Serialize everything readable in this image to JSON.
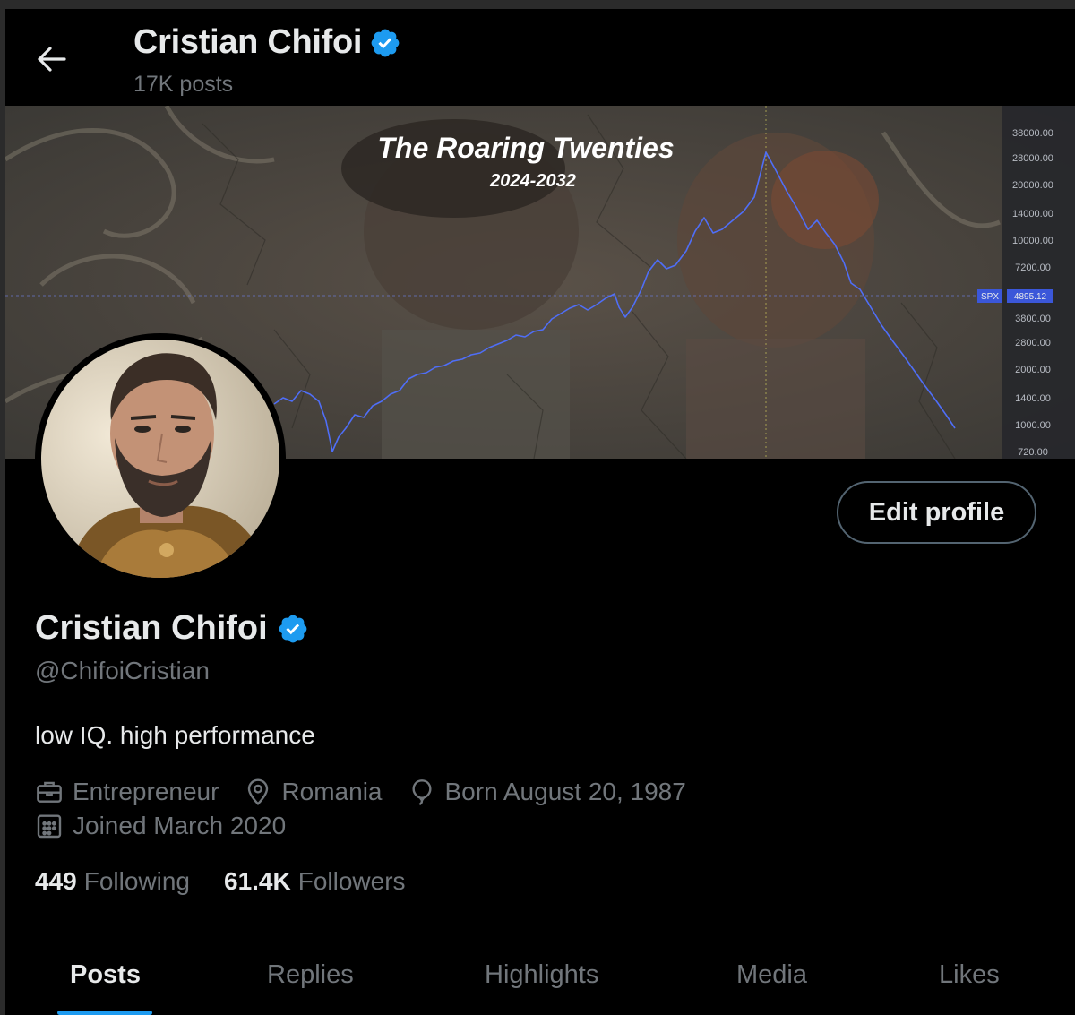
{
  "header": {
    "name": "Cristian Chifoi",
    "posts_count": "17K posts"
  },
  "banner": {
    "title": "The Roaring Twenties",
    "subtitle": "2024-2032",
    "chart_data": {
      "type": "line",
      "series_label": "SPX",
      "current_value": "4895.12",
      "y_ticks": [
        "38000.00",
        "28000.00",
        "20000.00",
        "14000.00",
        "10000.00",
        "7200.00",
        "3800.00",
        "2800.00",
        "2000.00",
        "1400.00",
        "1000.00",
        "720.00"
      ],
      "y_scale": "log",
      "line_color": "#4f6ef7"
    }
  },
  "profile": {
    "edit_label": "Edit profile",
    "name": "Cristian Chifoi",
    "handle": "@ChifoiCristian",
    "bio": "low IQ. high performance",
    "profession": "Entrepreneur",
    "location": "Romania",
    "birthday": "Born August 20, 1987",
    "joined": "Joined March 2020",
    "following_count": "449",
    "following_label": "Following",
    "followers_count": "61.4K",
    "followers_label": "Followers"
  },
  "tabs": [
    {
      "label": "Posts",
      "active": true
    },
    {
      "label": "Replies",
      "active": false
    },
    {
      "label": "Highlights",
      "active": false
    },
    {
      "label": "Media",
      "active": false
    },
    {
      "label": "Likes",
      "active": false
    }
  ],
  "colors": {
    "verified": "#1d9bf0",
    "tab_indicator": "#1d9bf0",
    "muted_text": "#71767b"
  }
}
